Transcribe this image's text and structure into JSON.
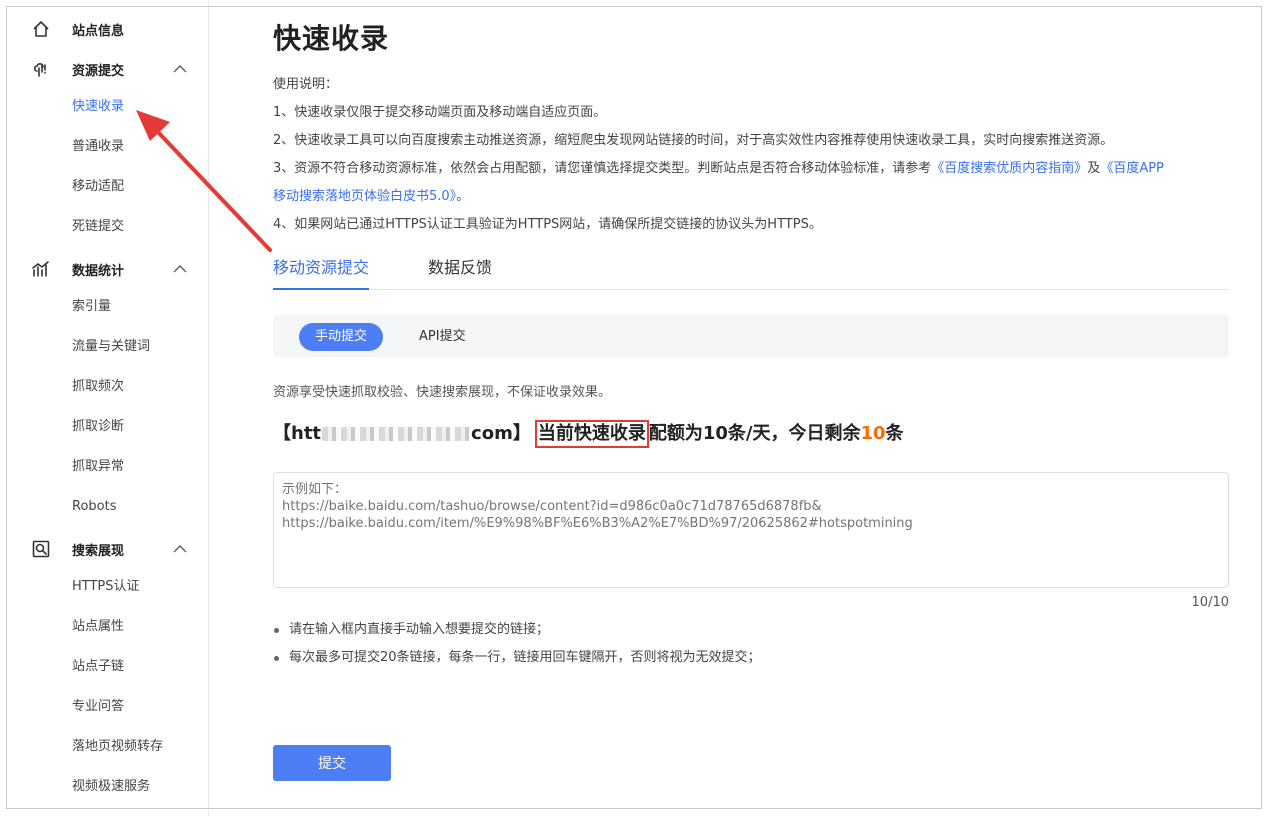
{
  "sidebar": {
    "groups": [
      {
        "label": "站点信息",
        "icon": "home-icon",
        "items": []
      },
      {
        "label": "资源提交",
        "icon": "resource-submit-icon",
        "items": [
          "快速收录",
          "普通收录",
          "移动适配",
          "死链提交"
        ]
      },
      {
        "label": "数据统计",
        "icon": "stats-icon",
        "items": [
          "索引量",
          "流量与关键词",
          "抓取频次",
          "抓取诊断",
          "抓取异常",
          "Robots"
        ]
      },
      {
        "label": "搜索展现",
        "icon": "search-display-icon",
        "items": [
          "HTTPS认证",
          "站点属性",
          "站点子链",
          "专业问答",
          "落地页视频转存",
          "视频极速服务"
        ]
      }
    ],
    "active_item": "快速收录"
  },
  "page": {
    "title": "快速收录",
    "instructions": {
      "heading": "使用说明：",
      "line1": "1、快速收录仅限于提交移动端页面及移动端自适应页面。",
      "line2": "2、快速收录工具可以向百度搜索主动推送资源，缩短爬虫发现网站链接的时间，对于高实效性内容推荐使用快速收录工具，实时向搜索推送资源。",
      "line3_prefix": "3、资源不符合移动资源标准，依然会占用配额，请您谨慎选择提交类型。判断站点是否符合移动体验标准，请参考",
      "link1": "《百度搜索优质内容指南》",
      "line3_mid": "及",
      "link2_part1": "《百度APP",
      "link2_part2": "移动搜索落地页体验白皮书5.0》",
      "line3_suffix": "。",
      "line4": "4、如果网站已通过HTTPS认证工具验证为HTTPS网站，请确保所提交链接的协议头为HTTPS。"
    },
    "tabs": [
      "移动资源提交",
      "数据反馈"
    ],
    "subtabs": [
      "手动提交",
      "API提交"
    ],
    "note": "资源享受快速抓取校验、快速搜索展现，不保证收录效果。",
    "quota": {
      "prefix": "【htt",
      "domain_suffix": "com】",
      "boxed": "当前快速收录",
      "middle": "配额为10条/天，今日剩余",
      "remaining": "10",
      "unit": "条"
    },
    "textarea_placeholder": "示例如下：\nhttps://baike.baidu.com/tashuo/browse/content?id=d986c0a0c71d78765d6878fb&\nhttps://baike.baidu.com/item/%E9%98%BF%E6%B3%A2%E7%BD%97/20625862#hotspotmining",
    "counter": "10/10",
    "bullets": [
      "请在输入框内直接手动输入想要提交的链接；",
      "每次最多可提交20条链接，每条一行，链接用回车键隔开，否则将视为无效提交；"
    ],
    "submit_label": "提交"
  },
  "colors": {
    "accent": "#3a6ff0",
    "button": "#4e7ef4",
    "highlight": "#ff6a00",
    "annotation": "#e53935"
  }
}
